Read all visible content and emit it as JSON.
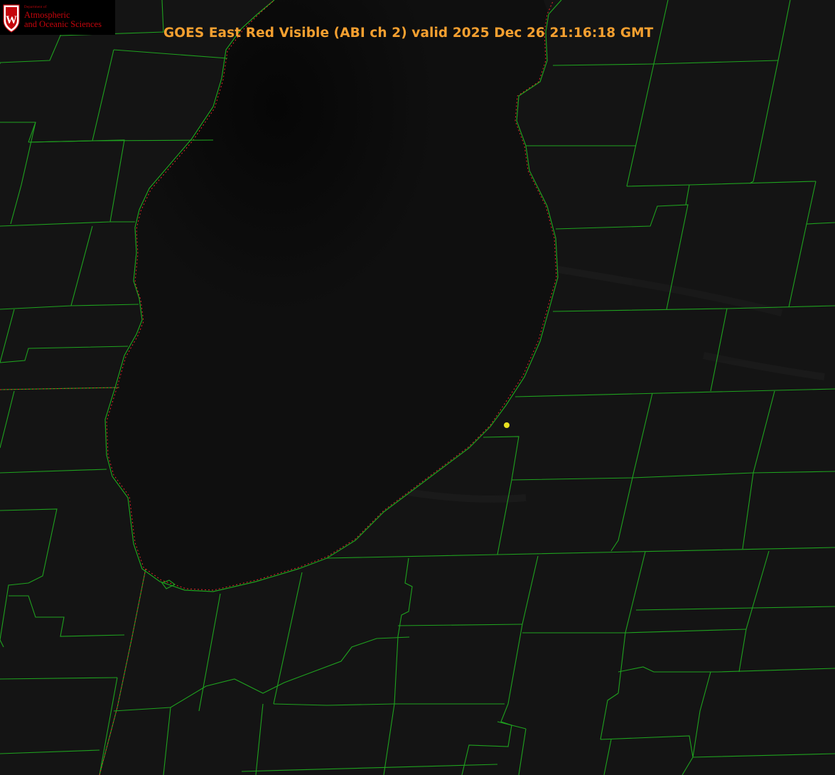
{
  "viewer": {
    "title": "GOES East Red Visible (ABI ch 2) valid 2025 Dec 26 21:16:18 GMT",
    "satellite": "GOES East",
    "product": "Red Visible (ABI ch 2)",
    "valid_time": "2025 Dec 26 21:16:18 GMT"
  },
  "logo": {
    "department_line": "Department of",
    "line1": "Atmospheric",
    "line2": "and Oceanic Sciences",
    "seal_letter": "W"
  },
  "colors": {
    "background": "#131313",
    "lake": "#0e0e0e",
    "county_lines": "#1fa21f",
    "coastline_red": "#e02a2a",
    "title_text": "#f5a030",
    "logo_red": "#c5050c",
    "marker": "#e8e020"
  },
  "icons": {
    "seal": "uw-crest-icon",
    "marker": "station-marker-icon"
  }
}
